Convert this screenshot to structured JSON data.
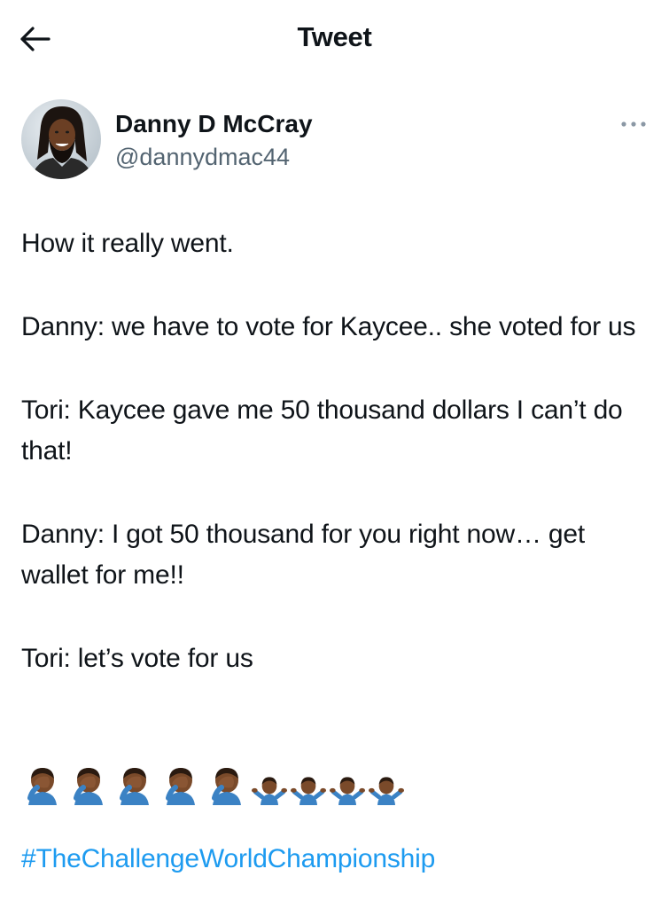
{
  "header": {
    "back_icon": "arrow-left-icon",
    "title": "Tweet"
  },
  "author": {
    "name": "Danny D McCray",
    "handle": "@dannydmac44",
    "avatar_icon": "profile-photo",
    "more_icon": "more-horizontal-icon"
  },
  "tweet": {
    "paragraphs": [
      "How it really went.",
      "Danny: we have to vote for Kaycee.. she voted for us",
      "Tori: Kaycee gave me 50 thousand dollars I can’t do that!",
      "Danny: I got 50 thousand for you right now… get wallet for me!!",
      "Tori: let’s vote for us"
    ],
    "emojis": [
      "person-facepalming-emoji",
      "person-facepalming-emoji",
      "person-facepalming-emoji",
      "person-facepalming-emoji",
      "person-facepalming-emoji",
      "person-shrugging-emoji",
      "person-shrugging-emoji",
      "person-shrugging-emoji",
      "person-shrugging-emoji"
    ],
    "hashtag": "#TheChallengeWorldChampionship"
  },
  "colors": {
    "text": "#0f1419",
    "secondary_text": "#536471",
    "link": "#1d9bf0",
    "skin": "#7a4a2a",
    "shirt": "#3b82c4"
  }
}
